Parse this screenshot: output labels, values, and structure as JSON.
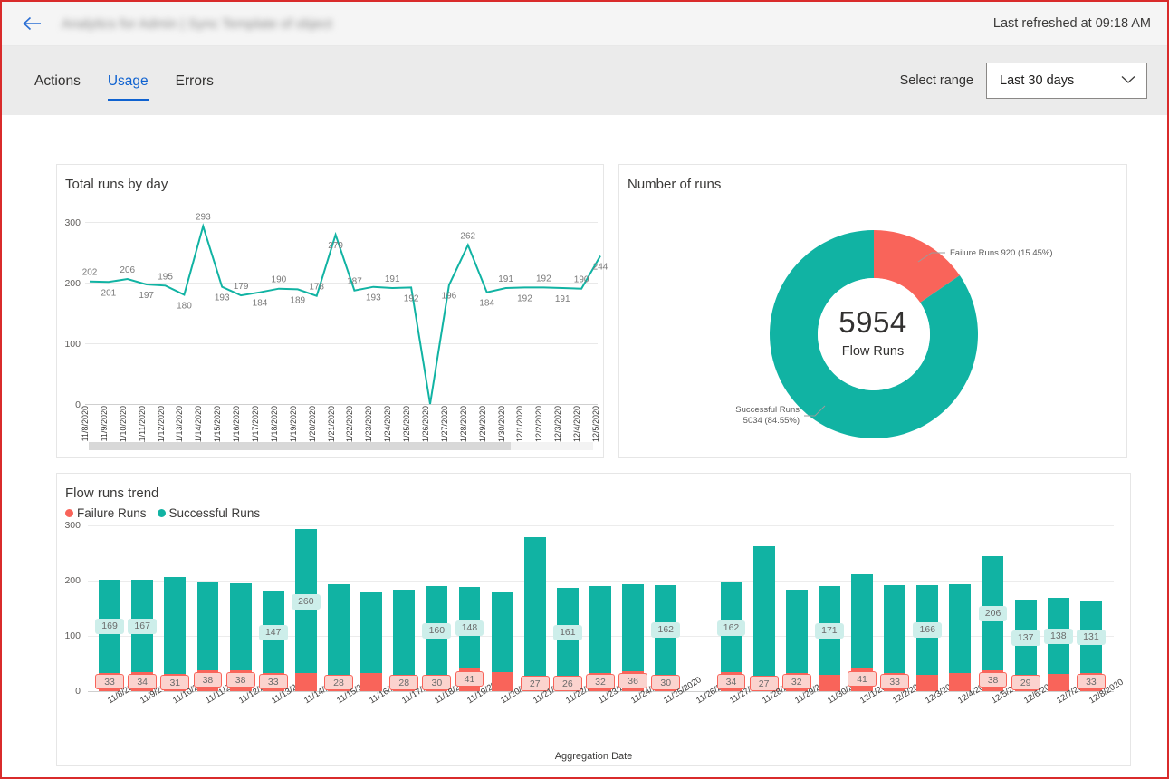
{
  "header": {
    "back_icon": "arrow-left-icon",
    "title": "Analytics for Admin | Sync Template of object",
    "refreshed": "Last refreshed at 09:18 AM"
  },
  "tabs": [
    {
      "label": "Actions",
      "active": false
    },
    {
      "label": "Usage",
      "active": true
    },
    {
      "label": "Errors",
      "active": false
    }
  ],
  "range": {
    "label": "Select range",
    "value": "Last 30 days",
    "chevron_icon": "chevron-down-icon",
    "options": [
      "Last 30 days"
    ]
  },
  "colors": {
    "success": "#11b3a3",
    "success_light": "#cdeeea",
    "failure": "#f9645a",
    "failure_light": "#fbd3ce",
    "accent": "#0f62d0",
    "grid": "#e9e9e9",
    "text": "#3b3a39"
  },
  "chart_data": [
    {
      "id": "total-runs-by-day",
      "type": "line",
      "title": "Total runs by day",
      "xlabel": "",
      "ylabel": "",
      "ylim": [
        0,
        300
      ],
      "yticks": [
        0,
        100,
        200,
        300
      ],
      "grid": true,
      "legend": "none",
      "series_color": "#11b3a3",
      "categories": [
        "11/8/2020",
        "11/9/2020",
        "11/10/2020",
        "11/11/2020",
        "11/12/2020",
        "11/13/2020",
        "11/14/2020",
        "11/15/2020",
        "11/16/2020",
        "11/17/2020",
        "11/18/2020",
        "11/19/2020",
        "11/20/2020",
        "11/21/2020",
        "11/22/2020",
        "11/23/2020",
        "11/24/2020",
        "11/25/2020",
        "11/26/2020",
        "11/27/2020",
        "11/28/2020",
        "11/29/2020",
        "11/30/2020",
        "12/1/2020",
        "12/2/2020",
        "12/3/2020",
        "12/4/2020",
        "12/5/2020"
      ],
      "values": [
        202,
        201,
        206,
        197,
        195,
        180,
        293,
        193,
        179,
        184,
        190,
        189,
        178,
        279,
        187,
        193,
        191,
        192,
        0,
        196,
        262,
        184,
        191,
        192,
        192,
        191,
        190,
        244
      ],
      "scroll": {
        "visible": true,
        "thumb_fraction": 0.84
      }
    },
    {
      "id": "number-of-runs",
      "type": "pie",
      "title": "Number of runs",
      "center_value": "5954",
      "center_label": "Flow Runs",
      "slices": [
        {
          "name": "Failure Runs",
          "value": 920,
          "percent": "15.45%",
          "label": "Failure Runs 920 (15.45%)",
          "color": "#f9645a"
        },
        {
          "name": "Successful Runs",
          "value": 5034,
          "percent": "84.55%",
          "label_line1": "Successful Runs",
          "label_line2": "5034 (84.55%)",
          "color": "#11b3a3"
        }
      ]
    },
    {
      "id": "flow-runs-trend",
      "type": "bar",
      "title": "Flow runs trend",
      "xlabel": "Aggregation Date",
      "ylabel": "",
      "ylim": [
        0,
        300
      ],
      "yticks": [
        0,
        100,
        200,
        300
      ],
      "stacked": true,
      "legend": [
        "Failure Runs",
        "Successful Runs"
      ],
      "legend_position": "top-left",
      "categories": [
        "11/8/2020",
        "11/9/2020",
        "11/10/2020",
        "11/11/2020",
        "11/12/2020",
        "11/13/2020",
        "11/14/2020",
        "11/15/2020",
        "11/16/2020",
        "11/17/2020",
        "11/18/2020",
        "11/19/2020",
        "11/20/2020",
        "11/21/2020",
        "11/22/2020",
        "11/23/2020",
        "11/24/2020",
        "11/25/2020",
        "11/26/2020",
        "11/27/2020",
        "11/28/2020",
        "11/29/2020",
        "11/30/2020",
        "12/1/2020",
        "12/2/2020",
        "12/3/2020",
        "12/4/2020",
        "12/5/2020",
        "12/6/2020",
        "12/7/2020",
        "12/8/2020"
      ],
      "series": [
        {
          "name": "Failure Runs",
          "color": "#f9645a",
          "values": [
            33,
            34,
            31,
            38,
            38,
            33,
            33,
            28,
            32,
            28,
            30,
            41,
            35,
            27,
            26,
            32,
            36,
            30,
            0,
            34,
            27,
            32,
            29,
            41,
            33,
            30,
            33,
            38,
            29,
            31,
            33
          ]
        },
        {
          "name": "Successful Runs",
          "color": "#11b3a3",
          "values": [
            169,
            167,
            175,
            159,
            157,
            147,
            260,
            165,
            147,
            156,
            160,
            148,
            143,
            252,
            161,
            159,
            158,
            162,
            0,
            162,
            235,
            152,
            162,
            171,
            159,
            162,
            160,
            206,
            137,
            138,
            131
          ]
        }
      ],
      "labeled_failures": [
        33,
        34,
        31,
        38,
        38,
        33,
        null,
        28,
        null,
        28,
        30,
        41,
        null,
        27,
        26,
        32,
        36,
        30,
        null,
        34,
        27,
        32,
        null,
        41,
        33,
        null,
        null,
        38,
        29,
        null,
        33
      ],
      "labeled_successes": [
        169,
        167,
        null,
        null,
        null,
        147,
        260,
        null,
        null,
        null,
        160,
        148,
        null,
        null,
        161,
        null,
        null,
        162,
        null,
        162,
        null,
        null,
        171,
        null,
        null,
        166,
        null,
        206,
        137,
        138,
        131
      ]
    }
  ]
}
